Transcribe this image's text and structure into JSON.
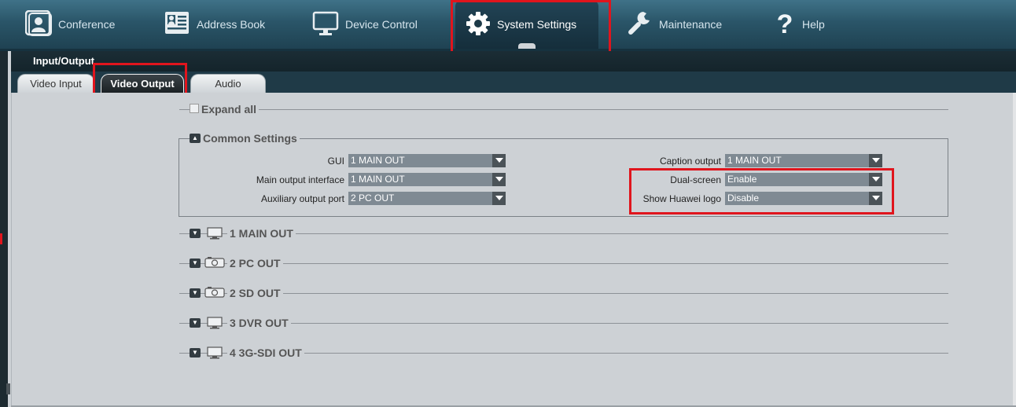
{
  "nav": {
    "items": [
      {
        "label": "Conference",
        "icon": "conference-icon"
      },
      {
        "label": "Address Book",
        "icon": "address-book-icon"
      },
      {
        "label": "Device Control",
        "icon": "monitor-icon"
      },
      {
        "label": "System Settings",
        "icon": "gear-icon",
        "active": true
      },
      {
        "label": "Maintenance",
        "icon": "wrench-icon"
      },
      {
        "label": "Help",
        "icon": "question-icon"
      }
    ]
  },
  "section": {
    "title": "Input/Output"
  },
  "tabs": [
    {
      "label": "Video Input",
      "active": false
    },
    {
      "label": "Video Output",
      "active": true
    },
    {
      "label": "Audio",
      "active": false
    }
  ],
  "expand_all": {
    "label": "Expand all",
    "checked": false
  },
  "common_settings": {
    "title": "Common Settings",
    "left_fields": [
      {
        "label": "GUI",
        "value": "1 MAIN OUT"
      },
      {
        "label": "Main output interface",
        "value": "1 MAIN OUT"
      },
      {
        "label": "Auxiliary output port",
        "value": "2 PC OUT"
      }
    ],
    "right_fields": [
      {
        "label": "Caption output",
        "value": "1 MAIN OUT"
      },
      {
        "label": "Dual-screen",
        "value": "Enable"
      },
      {
        "label": "Show Huawei logo",
        "value": "Disable"
      }
    ]
  },
  "outputs": [
    {
      "label": "1 MAIN OUT",
      "icon": "monitor-icon"
    },
    {
      "label": "2 PC OUT",
      "icon": "projector-icon"
    },
    {
      "label": "2 SD OUT",
      "icon": "projector-icon"
    },
    {
      "label": "3 DVR OUT",
      "icon": "monitor-icon"
    },
    {
      "label": "4 3G-SDI OUT",
      "icon": "monitor-icon"
    }
  ],
  "colors": {
    "highlight": "#e0151d",
    "nav_bg": "#2a5568",
    "select_bg": "#7f8a93",
    "page_bg": "#cdd1d5"
  }
}
